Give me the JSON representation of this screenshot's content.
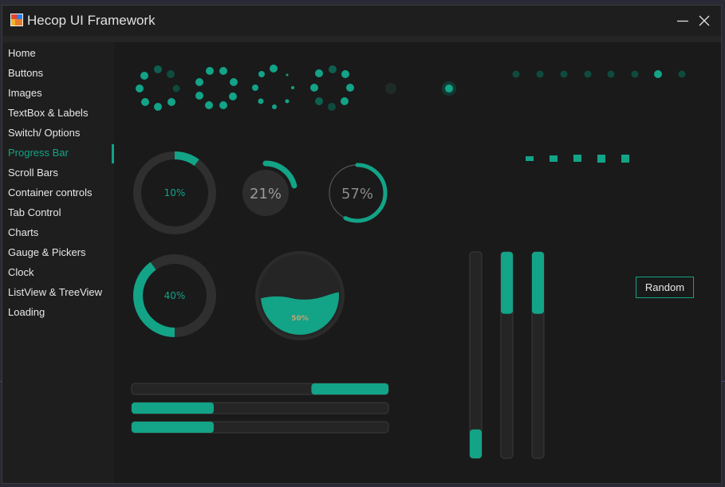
{
  "window": {
    "title": "Hecop UI Framework"
  },
  "colors": {
    "accent": "#13a387",
    "track": "#2f2f2f",
    "background": "#1a1a1a",
    "wave_text": "#c8a070"
  },
  "sidebar": {
    "active_index": 5,
    "items": [
      {
        "label": "Home"
      },
      {
        "label": "Buttons"
      },
      {
        "label": "Images"
      },
      {
        "label": "TextBox & Labels"
      },
      {
        "label": "Switch/ Options"
      },
      {
        "label": "Progress Bar"
      },
      {
        "label": "Scroll Bars"
      },
      {
        "label": "Container controls"
      },
      {
        "label": "Tab Control"
      },
      {
        "label": "Charts"
      },
      {
        "label": "Gauge & Pickers"
      },
      {
        "label": "Clock"
      },
      {
        "label": "ListView & TreeView"
      },
      {
        "label": "Loading"
      }
    ]
  },
  "progress": {
    "ring_thin": {
      "label": "10%",
      "value": 0.1
    },
    "pie_arc": {
      "label": "21%",
      "value": 0.21
    },
    "ring_outlined": {
      "label": "57%",
      "value": 0.57
    },
    "ring_thick": {
      "label": "40%",
      "value": 0.4
    },
    "wave": {
      "label": "50%",
      "value": 0.5
    },
    "bars": [
      {
        "start": 0.7,
        "end": 1.0
      },
      {
        "start": 0.0,
        "end": 0.32
      },
      {
        "start": 0.0,
        "end": 0.32
      }
    ],
    "vertical_bars": [
      {
        "start": 0.0,
        "end": 0.14
      },
      {
        "start": 0.7,
        "end": 1.0
      },
      {
        "start": 0.7,
        "end": 1.0
      }
    ]
  },
  "random_button": {
    "label": "Random"
  },
  "icons": {
    "app": "app-icon",
    "minimize": "minimize-icon",
    "close": "close-icon"
  }
}
